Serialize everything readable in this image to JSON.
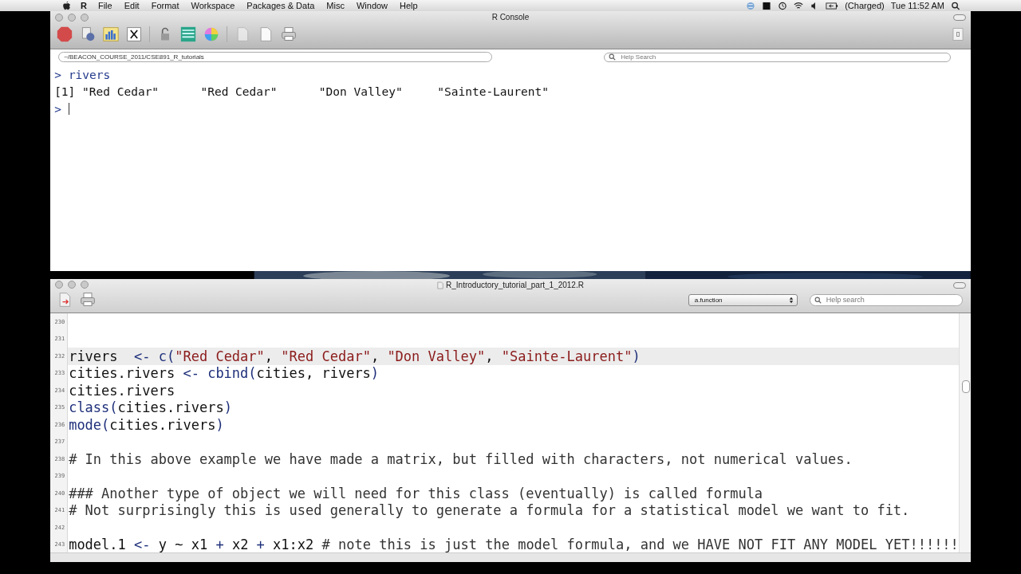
{
  "menu_bar": {
    "app": "R",
    "items": [
      "File",
      "Edit",
      "Format",
      "Workspace",
      "Packages & Data",
      "Misc",
      "Window",
      "Help"
    ],
    "battery": "(Charged)",
    "clock": "Tue 11:52 AM"
  },
  "console": {
    "title": "R Console",
    "path": "~/BEACON_COURSE_2011/CSE891_R_tutorials",
    "help_search": {
      "placeholder": "Help Search"
    },
    "lines": [
      {
        "kind": "input",
        "prompt": ">",
        "text": "rivers"
      },
      {
        "kind": "output",
        "text": "[1] \"Red Cedar\"      \"Red Cedar\"      \"Don Valley\"     \"Sainte-Laurent\""
      },
      {
        "kind": "input",
        "prompt": ">"
      }
    ]
  },
  "editor": {
    "title": "R_Introductory_tutorial_part_1_2012.R",
    "function_menu": "a.function",
    "help_search": {
      "placeholder": "Help search"
    },
    "lines": [
      {
        "number": "230",
        "highlighted": false
      },
      {
        "number": "231",
        "highlighted": false
      },
      {
        "number": "232",
        "highlighted": true,
        "segments": [
          {
            "kind": "plain",
            "text": "rivers  "
          },
          {
            "kind": "op",
            "text": "<- c("
          },
          {
            "kind": "string",
            "text": "\"Red Cedar\""
          },
          {
            "kind": "plain",
            "text": ", "
          },
          {
            "kind": "string",
            "text": "\"Red Cedar\""
          },
          {
            "kind": "plain",
            "text": ", "
          },
          {
            "kind": "string",
            "text": "\"Don Valley\""
          },
          {
            "kind": "plain",
            "text": ", "
          },
          {
            "kind": "string",
            "text": "\"Sainte-Laurent\""
          },
          {
            "kind": "op",
            "text": ")"
          }
        ]
      },
      {
        "number": "233",
        "highlighted": false,
        "segments": [
          {
            "kind": "plain",
            "text": "cities.rivers "
          },
          {
            "kind": "op",
            "text": "<- cbind("
          },
          {
            "kind": "plain",
            "text": "cities, rivers"
          },
          {
            "kind": "op",
            "text": ")"
          }
        ]
      },
      {
        "number": "234",
        "highlighted": false,
        "segments": [
          {
            "kind": "plain",
            "text": "cities.rivers"
          }
        ]
      },
      {
        "number": "235",
        "highlighted": false,
        "segments": [
          {
            "kind": "op",
            "text": "class("
          },
          {
            "kind": "plain",
            "text": "cities.rivers"
          },
          {
            "kind": "op",
            "text": ")"
          }
        ]
      },
      {
        "number": "236",
        "highlighted": false,
        "segments": [
          {
            "kind": "op",
            "text": "mode("
          },
          {
            "kind": "plain",
            "text": "cities.rivers"
          },
          {
            "kind": "op",
            "text": ")"
          }
        ]
      },
      {
        "number": "237",
        "highlighted": false
      },
      {
        "number": "238",
        "highlighted": false,
        "segments": [
          {
            "kind": "comment",
            "text": "# In this above example we have made a matrix, but filled with characters, not numerical values."
          }
        ]
      },
      {
        "number": "239",
        "highlighted": false
      },
      {
        "number": "240",
        "highlighted": false,
        "segments": [
          {
            "kind": "comment",
            "text": "### Another type of object we will need for this class (eventually) is called formula"
          }
        ]
      },
      {
        "number": "241",
        "highlighted": false,
        "segments": [
          {
            "kind": "comment",
            "text": "# Not surprisingly this is used generally to generate a formula for a statistical model we want to fit."
          }
        ]
      },
      {
        "number": "242",
        "highlighted": false
      },
      {
        "number": "243",
        "highlighted": false,
        "segments": [
          {
            "kind": "plain",
            "text": "model.1 "
          },
          {
            "kind": "op",
            "text": "<-"
          },
          {
            "kind": "plain",
            "text": " y ~ x1 "
          },
          {
            "kind": "op",
            "text": "+"
          },
          {
            "kind": "plain",
            "text": " x2 "
          },
          {
            "kind": "op",
            "text": "+"
          },
          {
            "kind": "plain",
            "text": " x1:x2 "
          },
          {
            "kind": "comment",
            "text": "# note this is just the model formula, and we HAVE NOT FIT ANY MODEL YET!!!!!!"
          }
        ]
      }
    ]
  }
}
